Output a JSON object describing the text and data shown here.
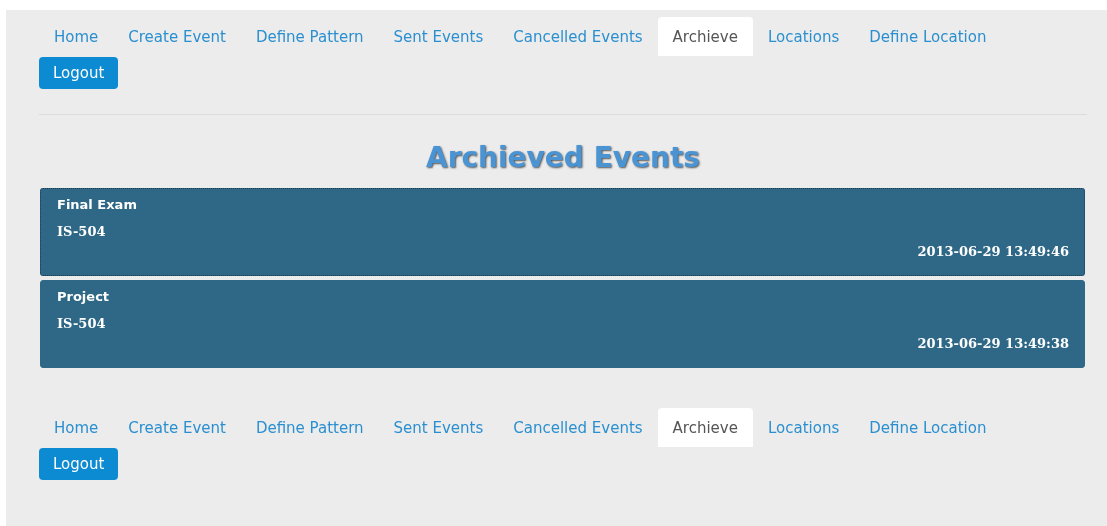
{
  "top_nav": {
    "tabs": [
      {
        "label": "Home",
        "selected": false
      },
      {
        "label": "Create Event",
        "selected": false
      },
      {
        "label": "Define Pattern",
        "selected": false
      },
      {
        "label": "Sent Events",
        "selected": false
      },
      {
        "label": "Cancelled Events",
        "selected": false
      },
      {
        "label": "Archieve",
        "selected": true
      },
      {
        "label": "Locations",
        "selected": false
      },
      {
        "label": "Define Location",
        "selected": false
      }
    ],
    "logout": "Logout"
  },
  "title": "Archieved Events",
  "events": [
    {
      "name": "Final Exam",
      "course": "IS-504",
      "timestamp": "2013-06-29 13:49:46",
      "selected": true
    },
    {
      "name": "Project",
      "course": "IS-504",
      "timestamp": "2013-06-29 13:49:38",
      "selected": false
    }
  ],
  "bottom_nav": {
    "tabs": [
      {
        "label": "Home",
        "selected": false
      },
      {
        "label": "Create Event",
        "selected": false
      },
      {
        "label": "Define Pattern",
        "selected": false
      },
      {
        "label": "Sent Events",
        "selected": false
      },
      {
        "label": "Cancelled Events",
        "selected": false
      },
      {
        "label": "Archieve",
        "selected": true
      },
      {
        "label": "Locations",
        "selected": false
      },
      {
        "label": "Define Location",
        "selected": false
      }
    ],
    "logout": "Logout"
  }
}
